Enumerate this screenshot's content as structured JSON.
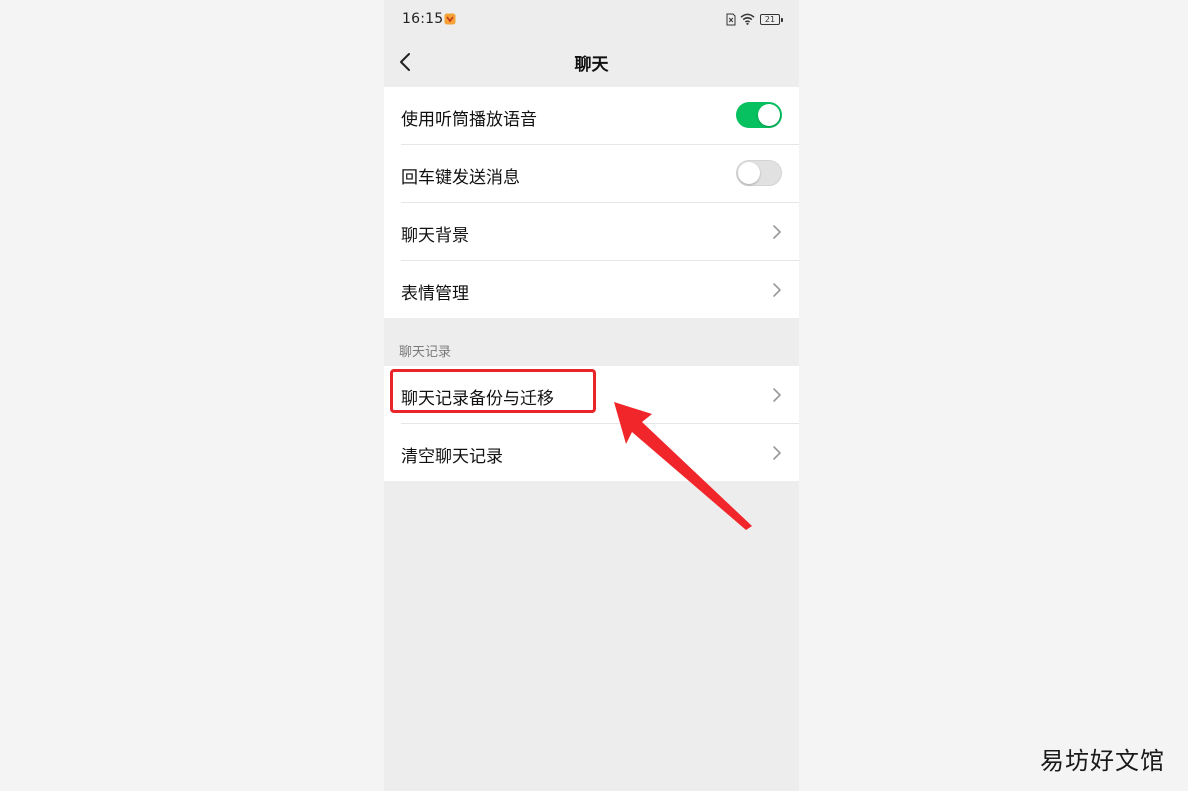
{
  "status_bar": {
    "time": "16:15",
    "battery": "21",
    "icons": [
      "app-notification-icon",
      "sim-icon",
      "wifi-icon",
      "battery-icon"
    ]
  },
  "nav": {
    "title": "聊天",
    "back_icon": "chevron-left-icon"
  },
  "settings_group_1": [
    {
      "label": "使用听筒播放语音",
      "control": "toggle",
      "state": "on"
    },
    {
      "label": "回车键发送消息",
      "control": "toggle",
      "state": "off"
    },
    {
      "label": "聊天背景",
      "control": "chevron"
    },
    {
      "label": "表情管理",
      "control": "chevron"
    }
  ],
  "section_header": "聊天记录",
  "settings_group_2": [
    {
      "label": "聊天记录备份与迁移",
      "control": "chevron",
      "highlighted": true
    },
    {
      "label": "清空聊天记录",
      "control": "chevron"
    }
  ],
  "annotation": {
    "highlight_color": "#e8262a",
    "arrow_color": "#f0262a"
  },
  "watermark": "易坊好文馆",
  "colors": {
    "toggle_on": "#07c160",
    "toggle_off": "#e1e1e1",
    "page_bg": "#ededed",
    "card_bg": "#ffffff"
  }
}
